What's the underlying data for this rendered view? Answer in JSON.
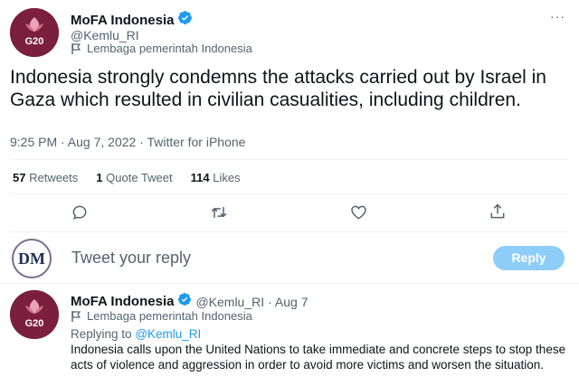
{
  "main_tweet": {
    "author_name": "MoFA Indonesia",
    "author_handle": "@Kemlu_RI",
    "account_label": "Lembaga pemerintah Indonesia",
    "avatar_text": "G20",
    "more_icon": "more-icon",
    "text": "Indonesia strongly condemns the attacks carried out by Israel in Gaza  which resulted in civilian casualities, including children.",
    "timestamp": "9:25 PM · Aug 7, 2022 · Twitter for iPhone",
    "stats": {
      "retweets_count": "57",
      "retweets_label": "Retweets",
      "quotes_count": "1",
      "quotes_label": "Quote Tweet",
      "likes_count": "114",
      "likes_label": "Likes"
    },
    "actions": [
      "reply-icon",
      "retweet-icon",
      "like-icon",
      "share-icon"
    ]
  },
  "composer": {
    "avatar_text": "DM",
    "placeholder": "Tweet your reply",
    "reply_button": "Reply"
  },
  "reply_tweet": {
    "author_name": "MoFA Indonesia",
    "author_handle": "@Kemlu_RI",
    "date": "· Aug 7",
    "account_label": "Lembaga pemerintah Indonesia",
    "avatar_text": "G20",
    "replying_prefix": "Replying to",
    "replying_to": "@Kemlu_RI",
    "text": "Indonesia calls upon  the United Nations to take immediate and  concrete steps to stop these acts of violence and aggression in order to avoid more victims and worsen the situation."
  },
  "colors": {
    "verified": "#1d9bf0",
    "avatar_bg": "#7a1f3d",
    "reply_button": "#8ecdf8"
  }
}
